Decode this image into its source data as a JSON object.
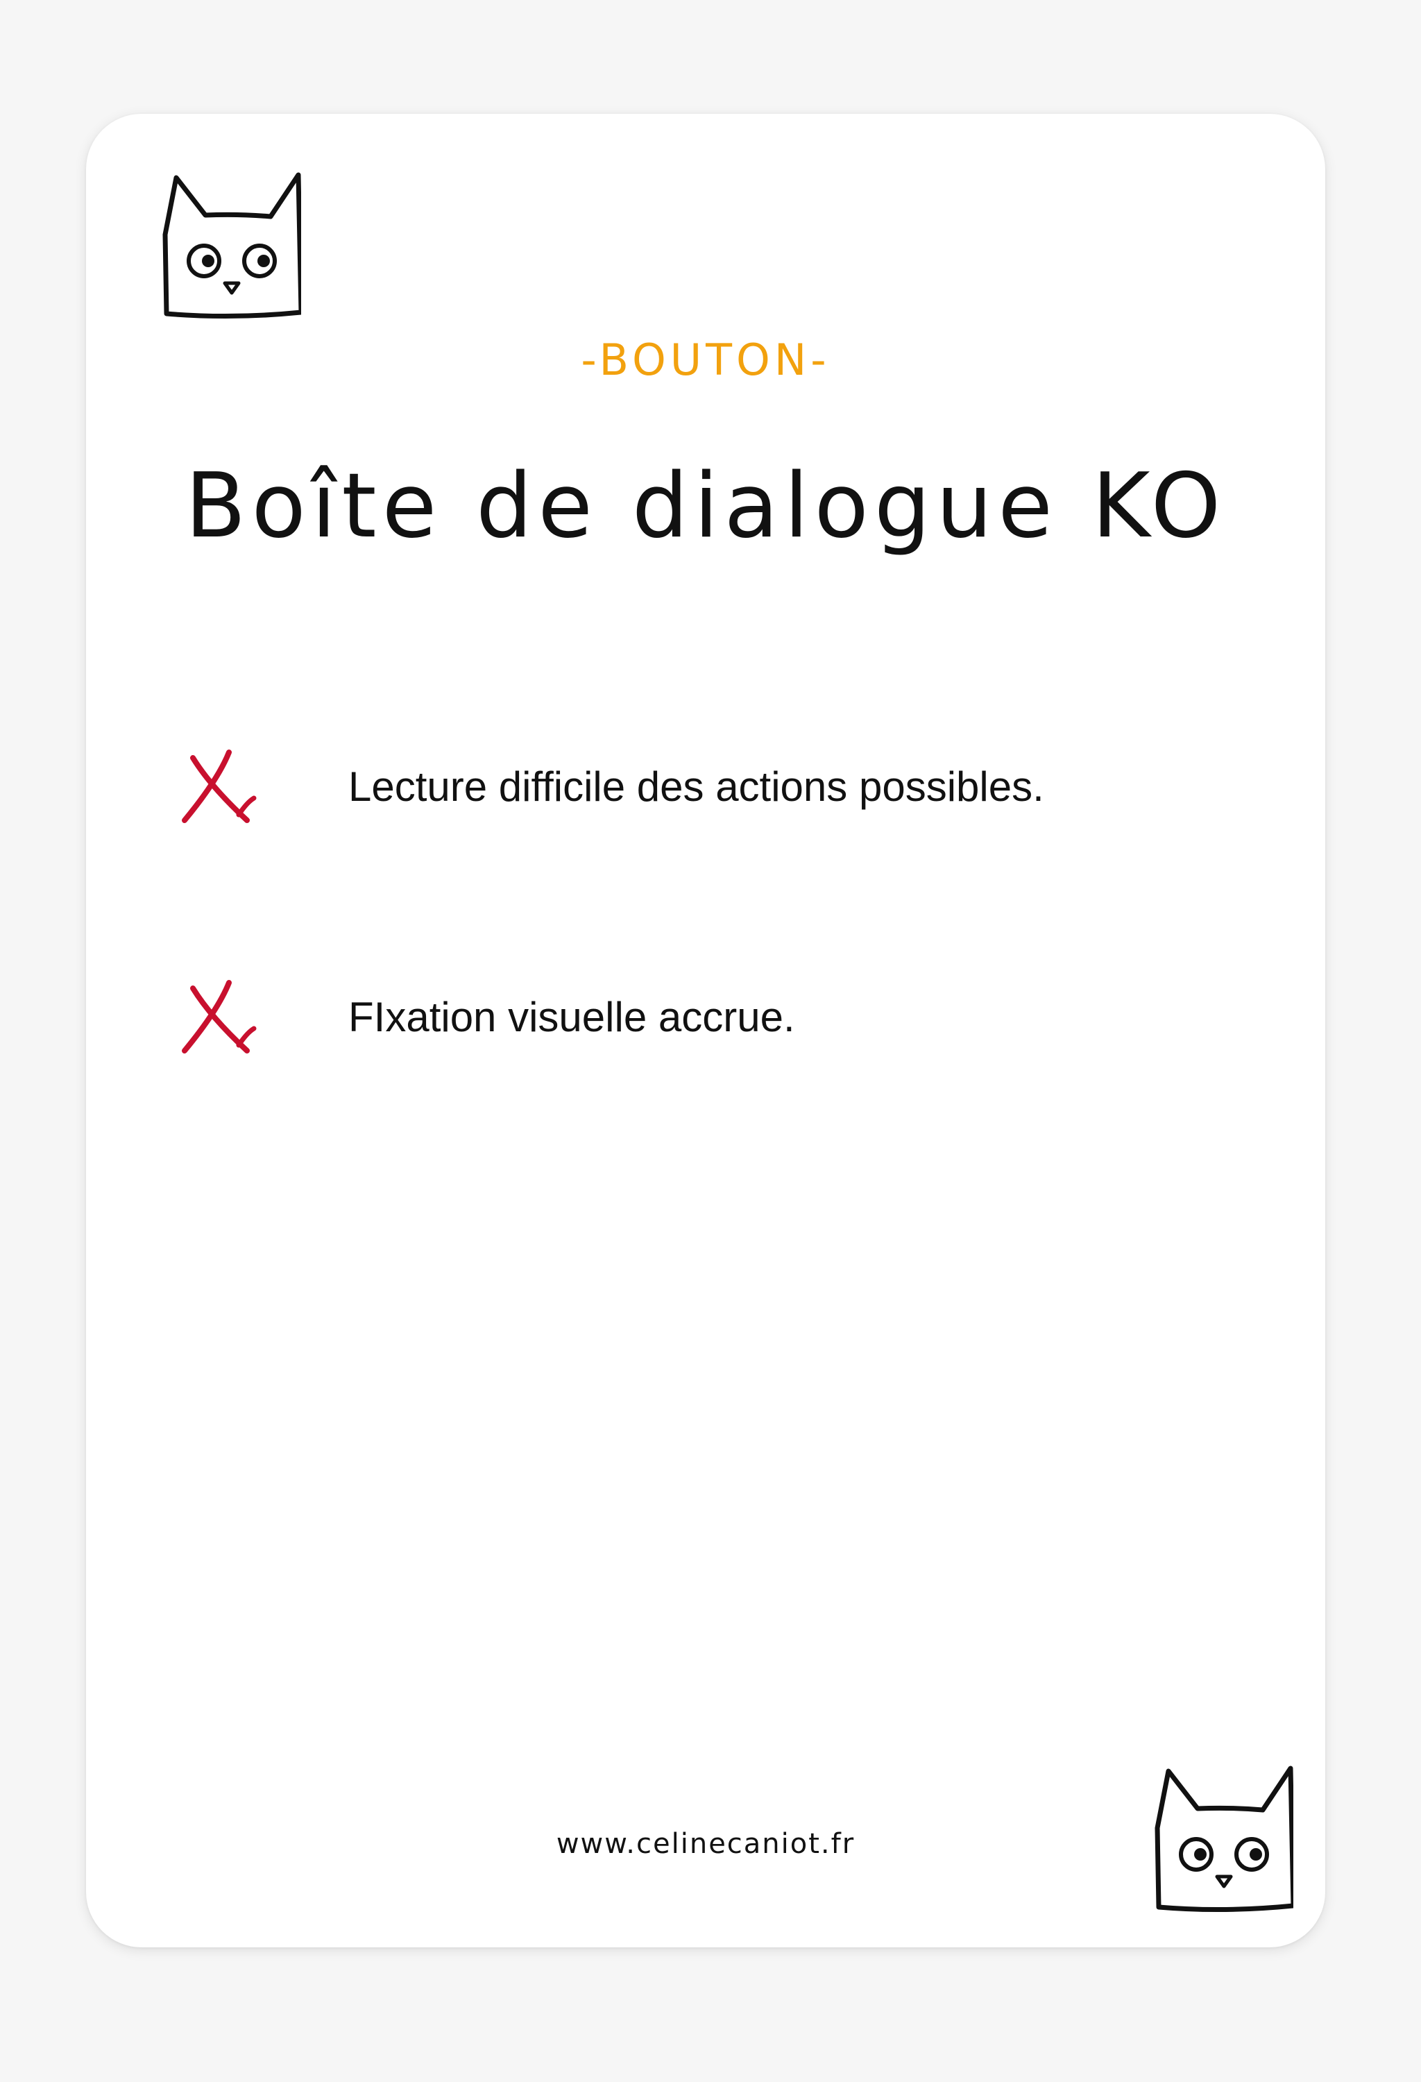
{
  "card": {
    "category": "-BOUTON-",
    "title": "Boîte de dialogue KO",
    "items": [
      {
        "icon": "red-cross-icon",
        "text": "Lecture difficile des actions possibles."
      },
      {
        "icon": "red-cross-icon",
        "text": "FIxation visuelle accrue."
      }
    ],
    "footer": "www.celinecaniot.fr"
  },
  "colors": {
    "accent": "#f2a10e",
    "cross": "#c8102e",
    "text": "#111111",
    "background": "#ffffff"
  }
}
